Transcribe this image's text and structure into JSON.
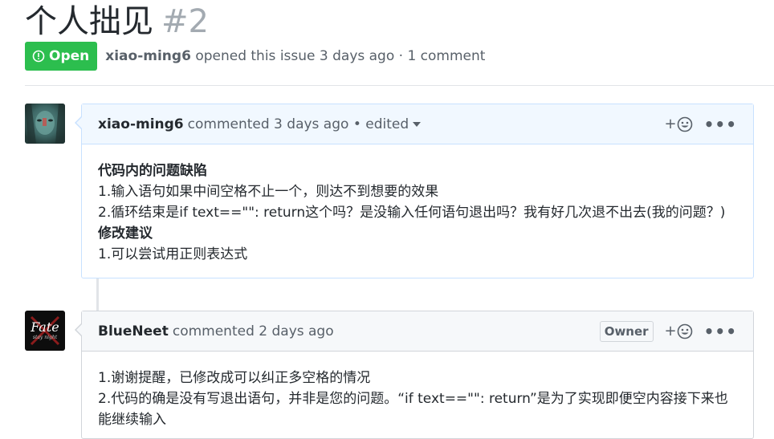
{
  "issue": {
    "title": "个人拙见",
    "number": "#2",
    "status": "Open",
    "author": "xiao-ming6",
    "opened_text": "opened this issue 3 days ago · 1 comment"
  },
  "comments": [
    {
      "author": "xiao-ming6",
      "meta": "commented 3 days ago • edited",
      "reaction_label": "+",
      "more_label": "•••",
      "lines": [
        "代码内的问题缺陷",
        "1.输入语句如果中间空格不止一个，则达不到想要的效果",
        "2.循环结束是if text==\"\": return这个吗？是没输入任何语句退出吗？我有好几次退不出去(我的问题？)",
        "修改建议",
        "1.可以尝试用正则表达式"
      ]
    },
    {
      "author": "BlueNeet",
      "meta": "commented 2 days ago",
      "badge": "Owner",
      "reaction_label": "+",
      "more_label": "•••",
      "avatar_text": "Fate",
      "avatar_subtext": "stay night",
      "lines": [
        "1.谢谢提醒，已修改成可以纠正多空格的情况",
        "2.代码的确是没有写退出语句，并非是您的问题。“if text==\"\": return”是为了实现即便空内容接下来也能继续输入"
      ]
    }
  ],
  "colors": {
    "open_badge": "#2cbe4e",
    "header_blue": "#f1f8ff",
    "border_blue": "#c8e1ff"
  }
}
